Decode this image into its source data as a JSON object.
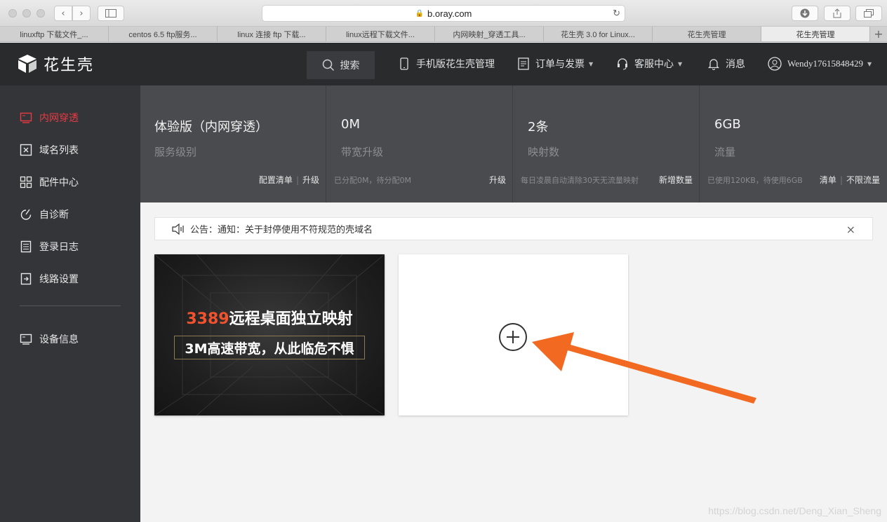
{
  "browser": {
    "url": "b.oray.com",
    "tabs": [
      {
        "title": "linuxftp 下载文件_..."
      },
      {
        "title": "centos 6.5 ftp服务..."
      },
      {
        "title": "linux 连接 ftp 下载..."
      },
      {
        "title": "linux远程下载文件..."
      },
      {
        "title": "内网映射_穿透工具..."
      },
      {
        "title": "花生壳 3.0 for Linux..."
      },
      {
        "title": "花生壳管理"
      },
      {
        "title": "花生壳管理",
        "active": true
      }
    ],
    "new_tab": "+"
  },
  "header": {
    "logo_text": "花生壳",
    "search_label": "搜索",
    "nav": {
      "mobile": "手机版花生壳管理",
      "orders": "订单与发票",
      "support": "客服中心",
      "messages": "消息",
      "user": "Wendy17615848429"
    }
  },
  "sidebar": {
    "items": [
      {
        "label": "内网穿透",
        "icon": "monitor-icon",
        "active": true
      },
      {
        "label": "域名列表",
        "icon": "domain-icon"
      },
      {
        "label": "配件中心",
        "icon": "grid-icon"
      },
      {
        "label": "自诊断",
        "icon": "diagnose-icon"
      },
      {
        "label": "登录日志",
        "icon": "log-icon"
      },
      {
        "label": "线路设置",
        "icon": "route-icon"
      }
    ],
    "device_info": "设备信息"
  },
  "stats": [
    {
      "value": "体验版（内网穿透）",
      "label": "服务级别",
      "note": "",
      "links": [
        "配置清单",
        "升级"
      ]
    },
    {
      "value": "0M",
      "label": "带宽升级",
      "note": "已分配0M，待分配0M",
      "links": [
        "升级"
      ]
    },
    {
      "value": "2条",
      "label": "映射数",
      "note": "每日凌晨自动清除30天无流量映射",
      "links": [
        "新增数量"
      ]
    },
    {
      "value": "6GB",
      "label": "流量",
      "note": "已使用120KB，待使用6GB",
      "links": [
        "清单",
        "不限流量"
      ]
    }
  ],
  "announcement": {
    "text": "公告：通知：关于封停使用不符规范的壳域名",
    "close": "×"
  },
  "promo": {
    "line1_highlight": "3389",
    "line1_rest": "远程桌面独立映射",
    "line2": "3M高速带宽，从此临危不惧"
  },
  "watermark": "https://blog.csdn.net/Deng_Xian_Sheng",
  "colors": {
    "accent_red": "#e83a45",
    "arrow_orange": "#f26a21",
    "header_bg": "#2a2b2d",
    "sidebar_bg": "#343538",
    "stats_bg": "#4a4b4e"
  }
}
